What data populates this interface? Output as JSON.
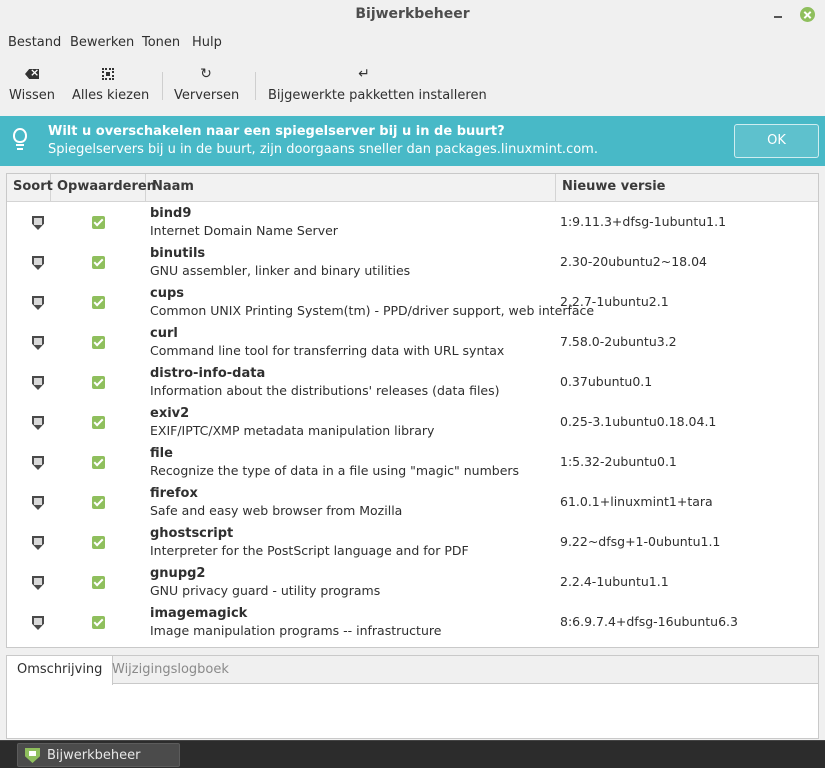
{
  "window": {
    "title": "Bijwerkbeheer"
  },
  "menu": [
    "Bestand",
    "Bewerken",
    "Tonen",
    "Hulp"
  ],
  "toolbar": {
    "clear": "Wissen",
    "select_all": "Alles kiezen",
    "refresh": "Verversen",
    "install": "Bijgewerkte pakketten installeren"
  },
  "infobar": {
    "title": "Wilt u overschakelen naar een spiegelserver bij u in de buurt?",
    "text": "Spiegelservers bij u in de buurt, zijn doorgaans sneller dan packages.linuxmint.com.",
    "ok": "OK"
  },
  "columns": [
    "Soort",
    "Opwaarderen",
    "Naam",
    "Nieuwe versie"
  ],
  "packages": [
    {
      "name": "bind9",
      "desc": "Internet Domain Name Server",
      "version": "1:9.11.3+dfsg-1ubuntu1.1",
      "upgrade": true
    },
    {
      "name": "binutils",
      "desc": "GNU assembler, linker and binary utilities",
      "version": "2.30-20ubuntu2~18.04",
      "upgrade": true
    },
    {
      "name": "cups",
      "desc": "Common UNIX Printing System(tm) - PPD/driver support, web interface",
      "version": "2.2.7-1ubuntu2.1",
      "upgrade": true
    },
    {
      "name": "curl",
      "desc": "Command line tool for transferring data with URL syntax",
      "version": "7.58.0-2ubuntu3.2",
      "upgrade": true
    },
    {
      "name": "distro-info-data",
      "desc": "Information about the distributions' releases (data files)",
      "version": "0.37ubuntu0.1",
      "upgrade": true
    },
    {
      "name": "exiv2",
      "desc": "EXIF/IPTC/XMP metadata manipulation library",
      "version": "0.25-3.1ubuntu0.18.04.1",
      "upgrade": true
    },
    {
      "name": "file",
      "desc": "Recognize the type of data in a file using \"magic\" numbers",
      "version": "1:5.32-2ubuntu0.1",
      "upgrade": true
    },
    {
      "name": "firefox",
      "desc": "Safe and easy web browser from Mozilla",
      "version": "61.0.1+linuxmint1+tara",
      "upgrade": true
    },
    {
      "name": "ghostscript",
      "desc": "Interpreter for the PostScript language and for PDF",
      "version": "9.22~dfsg+1-0ubuntu1.1",
      "upgrade": true
    },
    {
      "name": "gnupg2",
      "desc": "GNU privacy guard - utility programs",
      "version": "2.2.4-1ubuntu1.1",
      "upgrade": true
    },
    {
      "name": "imagemagick",
      "desc": "Image manipulation programs -- infrastructure",
      "version": "8:6.9.7.4+dfsg-16ubuntu6.3",
      "upgrade": true
    }
  ],
  "tabs": {
    "description": "Omschrijving",
    "changelog": "Wijzigingslogboek"
  },
  "taskbar": {
    "app_label": "Bijwerkbeheer"
  },
  "colors": {
    "accent": "#48b9c7",
    "check": "#8fbf5d"
  }
}
